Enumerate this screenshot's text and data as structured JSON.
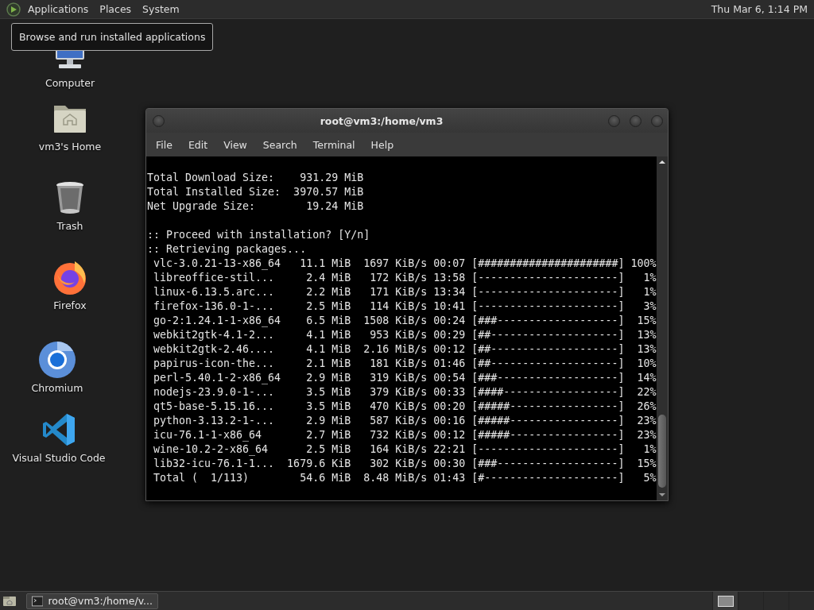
{
  "top_panel": {
    "menus": [
      "Applications",
      "Places",
      "System"
    ],
    "clock": "Thu Mar 6, 1:14 PM"
  },
  "tooltip": "Browse and run installed applications",
  "desktop_icons": [
    {
      "label": "Computer",
      "kind": "computer"
    },
    {
      "label": "vm3's Home",
      "kind": "home"
    },
    {
      "label": "Trash",
      "kind": "trash"
    },
    {
      "label": "Firefox",
      "kind": "firefox"
    },
    {
      "label": "Chromium",
      "kind": "chromium"
    },
    {
      "label": "Visual Studio Code",
      "kind": "vscode"
    }
  ],
  "terminal": {
    "title": "root@vm3:/home/vm3",
    "menus": [
      "File",
      "Edit",
      "View",
      "Search",
      "Terminal",
      "Help"
    ],
    "summary": [
      "Total Download Size:    931.29 MiB",
      "Total Installed Size:  3970.57 MiB",
      "Net Upgrade Size:        19.24 MiB"
    ],
    "messages": [
      ":: Proceed with installation? [Y/n]",
      ":: Retrieving packages..."
    ],
    "downloads": [
      " vlc-3.0.21-13-x86_64   11.1 MiB  1697 KiB/s 00:07 [######################] 100%",
      " libreoffice-stil...     2.4 MiB   172 KiB/s 13:58 [----------------------]   1%",
      " linux-6.13.5.arc...     2.2 MiB   171 KiB/s 13:34 [----------------------]   1%",
      " firefox-136.0-1-...     2.5 MiB   114 KiB/s 10:41 [----------------------]   3%",
      " go-2:1.24.1-1-x86_64    6.5 MiB  1508 KiB/s 00:24 [###-------------------]  15%",
      " webkit2gtk-4.1-2...     4.1 MiB   953 KiB/s 00:29 [##--------------------]  13%",
      " webkit2gtk-2.46....     4.1 MiB  2.16 MiB/s 00:12 [##--------------------]  13%",
      " papirus-icon-the...     2.1 MiB   181 KiB/s 01:46 [##--------------------]  10%",
      " perl-5.40.1-2-x86_64    2.9 MiB   319 KiB/s 00:54 [###-------------------]  14%",
      " nodejs-23.9.0-1-...     3.5 MiB   379 KiB/s 00:33 [####------------------]  22%",
      " qt5-base-5.15.16...     3.5 MiB   470 KiB/s 00:20 [#####-----------------]  26%",
      " python-3.13.2-1-...     2.9 MiB   587 KiB/s 00:16 [#####-----------------]  23%",
      " icu-76.1-1-x86_64       2.7 MiB   732 KiB/s 00:12 [#####-----------------]  23%",
      " wine-10.2-2-x86_64      2.5 MiB   164 KiB/s 22:21 [----------------------]   1%",
      " lib32-icu-76.1-1...  1679.6 KiB   302 KiB/s 00:30 [###-------------------]  15%",
      " Total (  1/113)        54.6 MiB  8.48 MiB/s 01:43 [#---------------------]   5%"
    ]
  },
  "taskbar": {
    "windows": [
      {
        "label": "root@vm3:/home/v...",
        "selected": false
      }
    ]
  }
}
